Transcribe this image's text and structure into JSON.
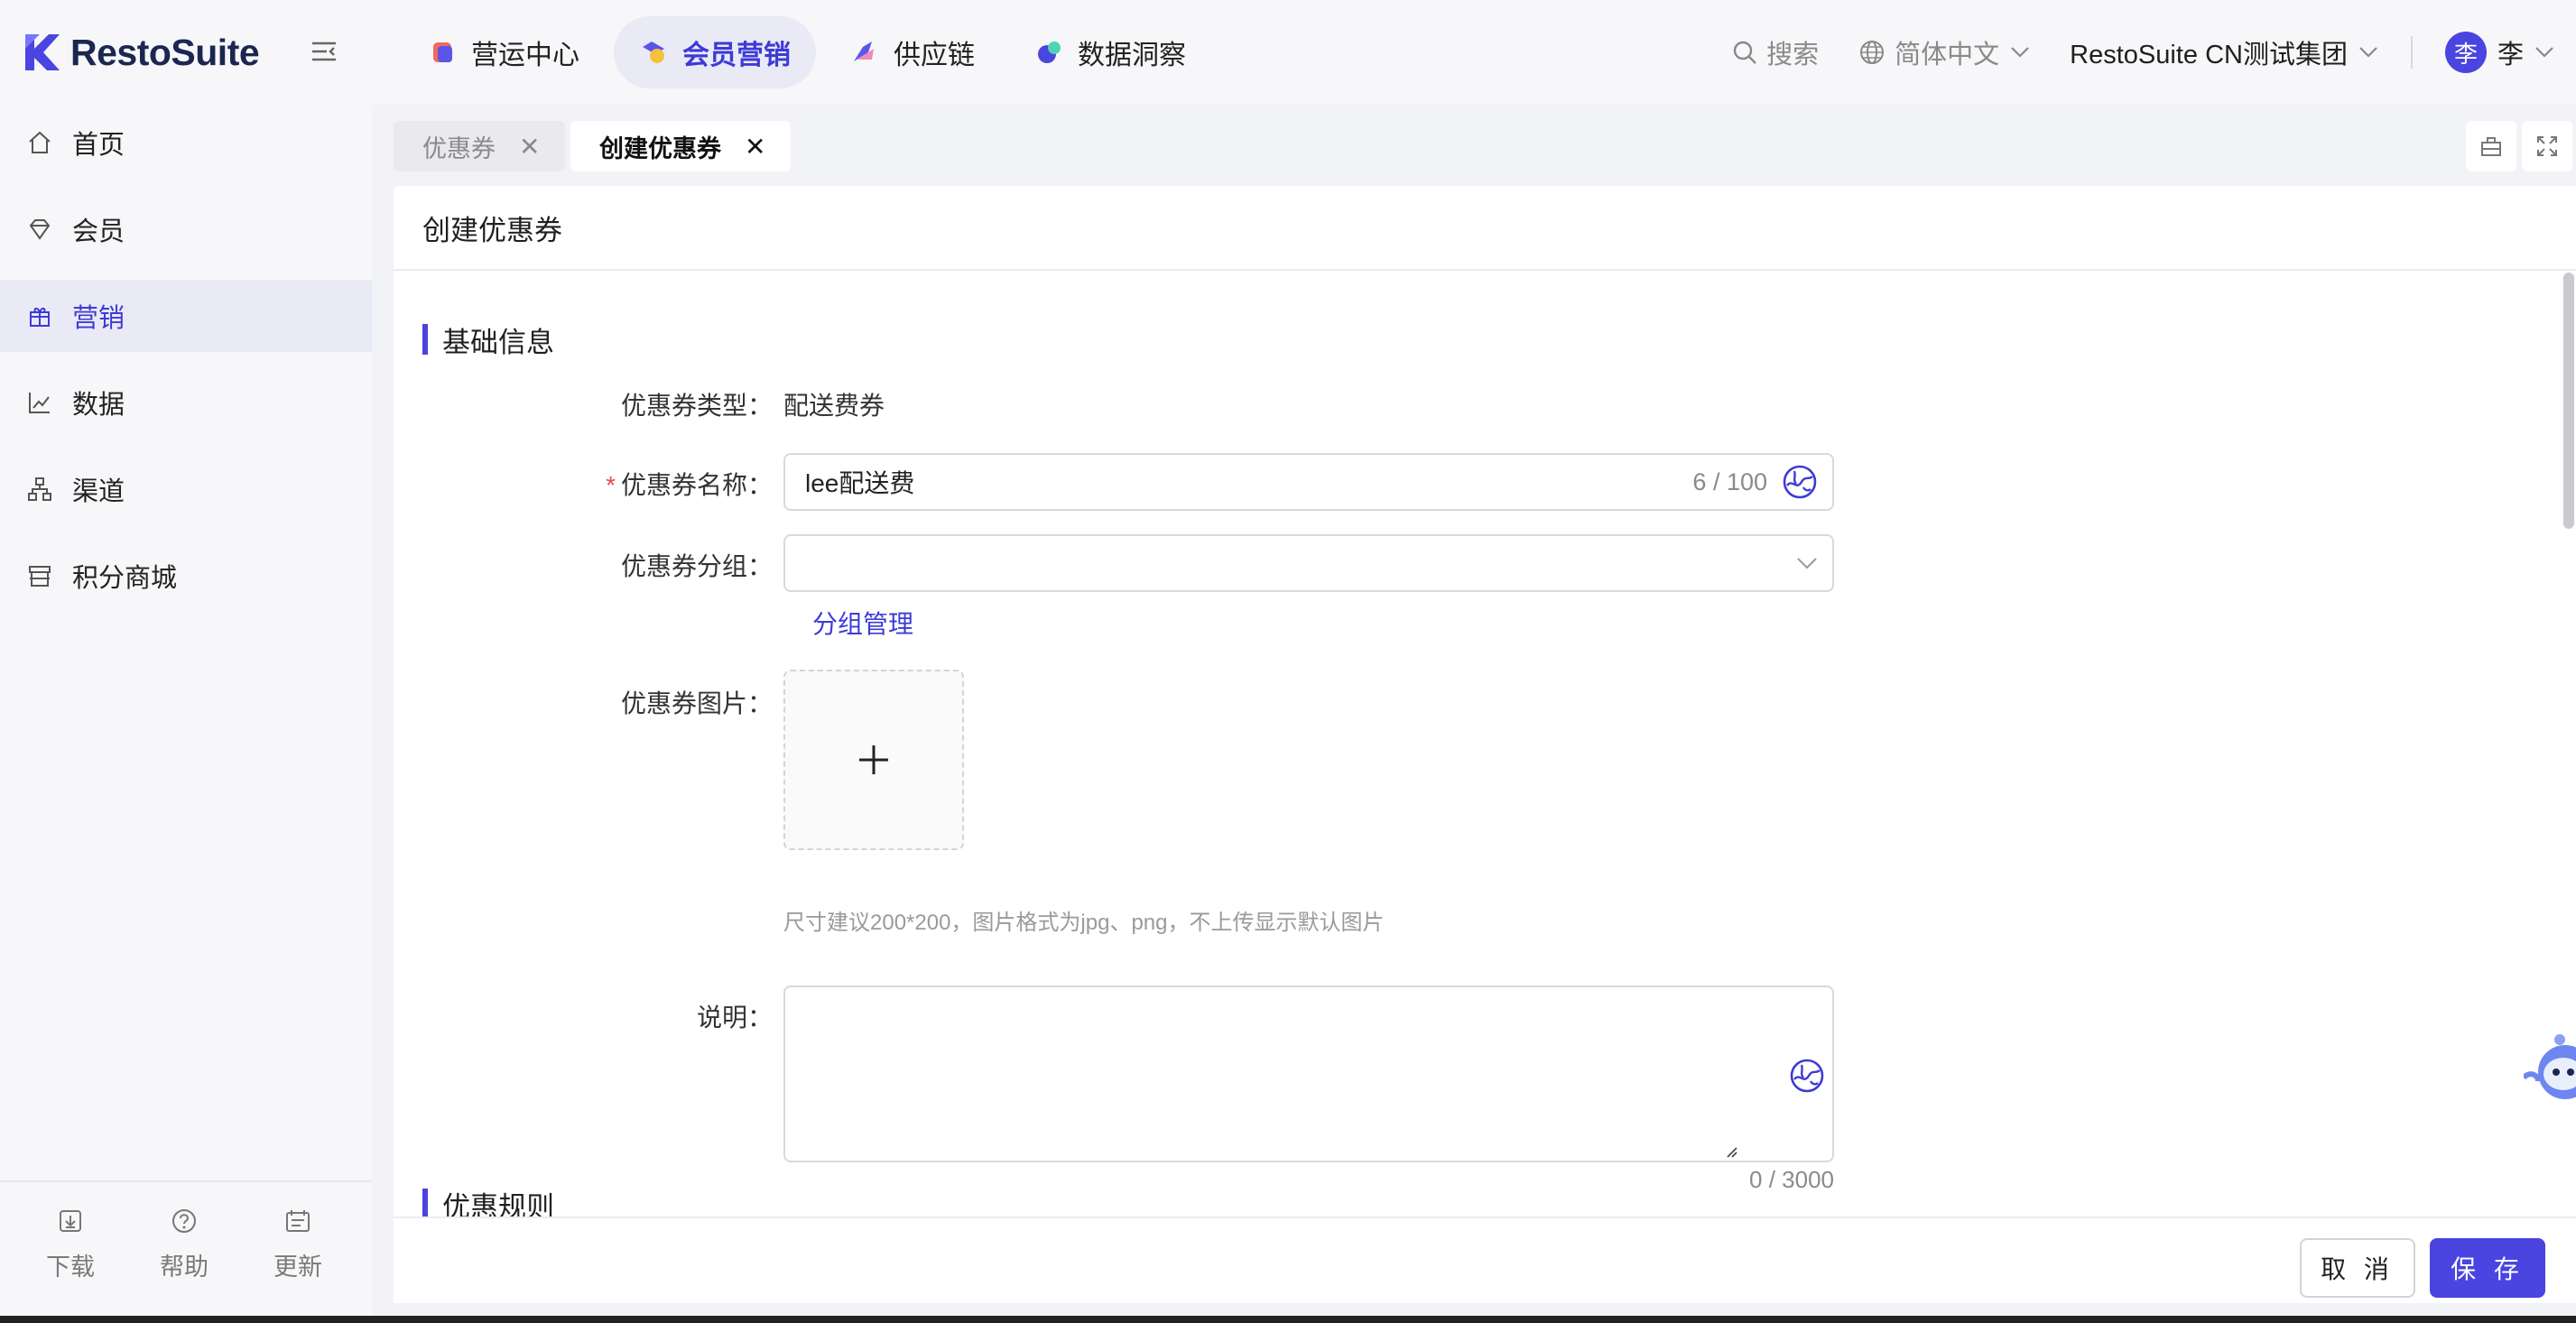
{
  "brand": {
    "name": "RestoSuite",
    "accent": "#4a44e0"
  },
  "top_nav": [
    {
      "label": "营运中心",
      "icon": "operations-icon"
    },
    {
      "label": "会员营销",
      "icon": "member-marketing-icon",
      "active": true
    },
    {
      "label": "供应链",
      "icon": "supply-chain-icon"
    },
    {
      "label": "数据洞察",
      "icon": "data-insight-icon"
    }
  ],
  "top_right": {
    "search_label": "搜索",
    "language": "简体中文",
    "org": "RestoSuite CN测试集团",
    "avatar_char": "李",
    "user_name": "李"
  },
  "sidebar": {
    "items": [
      {
        "label": "首页",
        "icon": "home-icon"
      },
      {
        "label": "会员",
        "icon": "diamond-icon"
      },
      {
        "label": "营销",
        "icon": "gift-icon",
        "active": true
      },
      {
        "label": "数据",
        "icon": "chart-icon"
      },
      {
        "label": "渠道",
        "icon": "channel-icon"
      },
      {
        "label": "积分商城",
        "icon": "store-icon"
      }
    ],
    "footer": [
      {
        "label": "下载",
        "icon": "download-icon"
      },
      {
        "label": "帮助",
        "icon": "help-icon"
      },
      {
        "label": "更新",
        "icon": "update-icon"
      }
    ]
  },
  "tabs": [
    {
      "label": "优惠券",
      "active": false
    },
    {
      "label": "创建优惠券",
      "active": true
    }
  ],
  "page": {
    "title": "创建优惠券",
    "section_basic": "基础信息",
    "section_rules": "优惠规则",
    "fields": {
      "type_label": "优惠券类型：",
      "type_value": "配送费券",
      "name_label": "优惠券名称：",
      "name_value": "lee配送费",
      "name_count": "6 / 100",
      "group_label": "优惠券分组：",
      "group_value": "",
      "group_manage_link": "分组管理",
      "image_label": "优惠券图片：",
      "image_hint": "尺寸建议200*200，图片格式为jpg、png，不上传显示默认图片",
      "desc_label": "说明：",
      "desc_value": "",
      "desc_count": "0 / 3000"
    }
  },
  "actions": {
    "cancel": "取 消",
    "save": "保 存"
  }
}
